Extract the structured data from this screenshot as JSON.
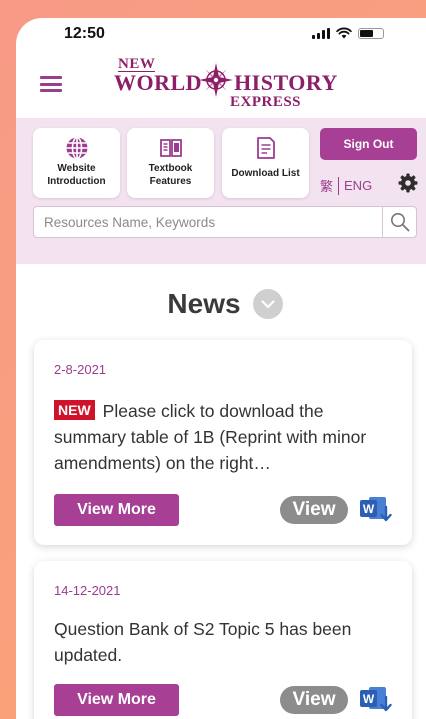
{
  "status_bar": {
    "time": "12:50"
  },
  "logo": {
    "new": "NEW",
    "world": "WORLD",
    "history": "HISTORY",
    "express": "EXPRESS"
  },
  "toolbar": {
    "website_intro": "Website\nIntroduction",
    "textbook_features": "Textbook\nFeatures",
    "download_list": "Download List",
    "sign_out": "Sign Out",
    "lang_trad": "繁",
    "lang_eng": "ENG"
  },
  "search": {
    "placeholder": "Resources Name, Keywords"
  },
  "news": {
    "heading": "News",
    "items": [
      {
        "date": "2-8-2021",
        "badge": "NEW",
        "text": "Please click to download the summary table of 1B (Reprint with minor amendments) on the right…",
        "view_more": "View More",
        "view": "View"
      },
      {
        "date": "14-12-2021",
        "text": "Question Bank of S2 Topic 5 has been updated.",
        "view_more": "View More",
        "view": "View"
      }
    ]
  },
  "colors": {
    "accent": "#a73f95",
    "toolbar_bg": "#f3e3f0",
    "new_badge": "#d0122b",
    "word_blue": "#2b5fb3"
  },
  "icons": [
    "hamburger-menu-icon",
    "globe-icon",
    "book-icon",
    "document-list-icon",
    "gear-icon",
    "search-icon",
    "chevron-down-icon",
    "word-download-icon"
  ]
}
